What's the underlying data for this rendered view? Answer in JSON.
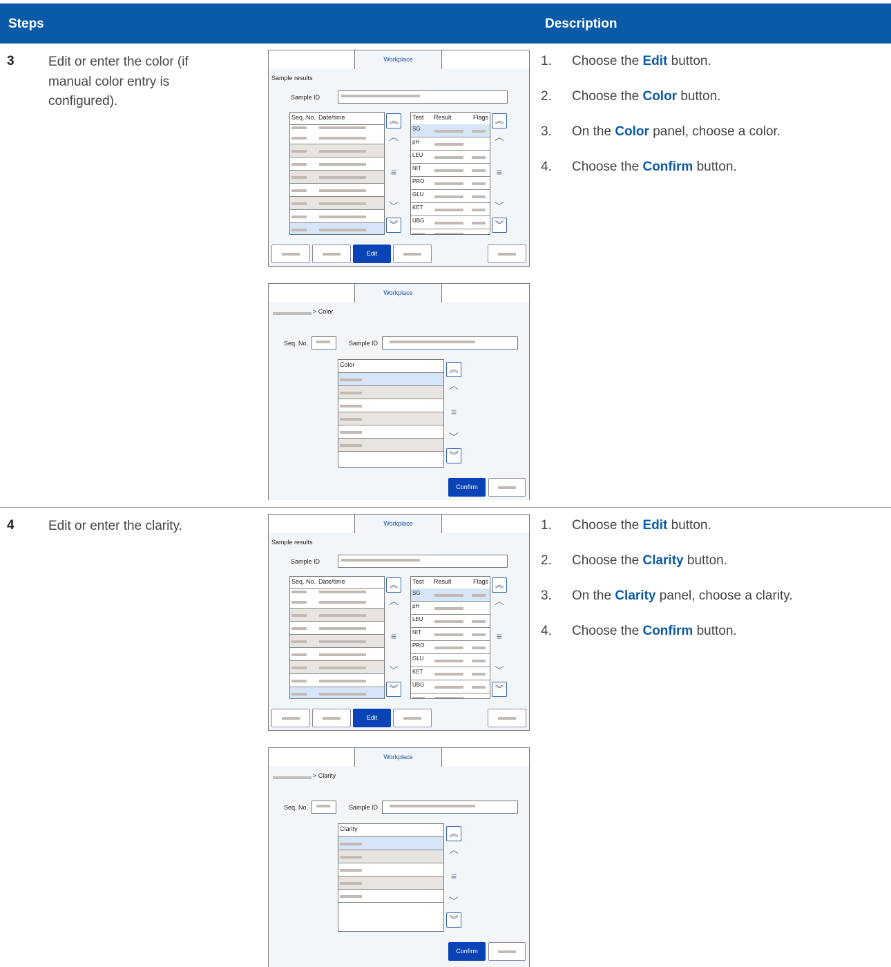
{
  "header": {
    "steps": "Steps",
    "description": "Description"
  },
  "steps": [
    {
      "number": "3",
      "text": "Edit or enter the color (if manual color entry is configured).",
      "instructions": [
        {
          "n": "1.",
          "pre": "Choose the ",
          "bold": "Edit",
          "post": " button."
        },
        {
          "n": "2.",
          "pre": "Choose the ",
          "bold": "Color",
          "post": " button."
        },
        {
          "n": "3.",
          "pre": "On the ",
          "bold": "Color",
          "post": " panel, choose a color."
        },
        {
          "n": "4.",
          "pre": "Choose the ",
          "bold": "Confirm",
          "post": " button."
        }
      ],
      "results_screen": {
        "tab": "Workplace",
        "title": "Sample results",
        "sample_id_label": "Sample ID",
        "list_headers": [
          "Seq. No.",
          "Date/time"
        ],
        "test_headers": [
          "Test",
          "Result",
          "Flags"
        ],
        "tests": [
          "SG",
          "pH",
          "LEU",
          "NIT",
          "PRO",
          "GLU",
          "KET",
          "UBG"
        ],
        "edit_label": "Edit"
      },
      "panel_screen": {
        "tab": "Workplace",
        "breadcrumb": "> Color",
        "seq_label": "Seq. No.",
        "sample_id_label": "Sample ID",
        "list_header": "Color",
        "confirm_label": "Confirm"
      }
    },
    {
      "number": "4",
      "text": "Edit or enter the clarity.",
      "instructions": [
        {
          "n": "1.",
          "pre": "Choose the ",
          "bold": "Edit",
          "post": " button."
        },
        {
          "n": "2.",
          "pre": "Choose the ",
          "bold": "Clarity",
          "post": " button."
        },
        {
          "n": "3.",
          "pre": "On the ",
          "bold": "Clarity",
          "post": " panel, choose a clarity."
        },
        {
          "n": "4.",
          "pre": "Choose the ",
          "bold": "Confirm",
          "post": " button."
        }
      ],
      "results_screen": {
        "tab": "Workplace",
        "title": "Sample results",
        "sample_id_label": "Sample ID",
        "list_headers": [
          "Seq. No.",
          "Date/time"
        ],
        "test_headers": [
          "Test",
          "Result",
          "Flags"
        ],
        "tests": [
          "SG",
          "pH",
          "LEU",
          "NIT",
          "PRO",
          "GLU",
          "KET",
          "UBG"
        ],
        "edit_label": "Edit"
      },
      "panel_screen": {
        "tab": "Workplace",
        "breadcrumb": "> Clarity",
        "seq_label": "Seq. No.",
        "sample_id_label": "Sample ID",
        "list_header": "Clarity",
        "confirm_label": "Confirm"
      }
    }
  ],
  "icons": {
    "page_up": "double-chevron-up-icon",
    "line_up": "chevron-up-icon",
    "scroll_thumb": "scroll-thumb-icon",
    "line_down": "chevron-down-icon",
    "page_down": "double-chevron-down-icon"
  }
}
